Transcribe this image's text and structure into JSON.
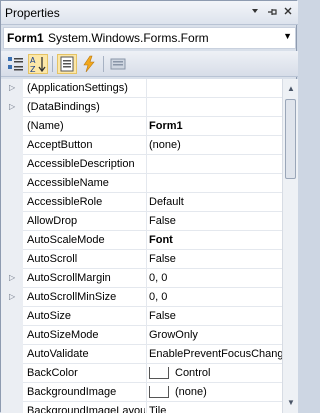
{
  "window": {
    "title": "Properties"
  },
  "object_selector": {
    "name": "Form1",
    "type": "System.Windows.Forms.Form"
  },
  "toolbar": {
    "buttons": [
      {
        "icon": "categorized-icon",
        "active": false
      },
      {
        "icon": "alphabetical-icon",
        "active": true
      },
      {
        "icon": "properties-icon",
        "active": true
      },
      {
        "icon": "events-icon",
        "active": false
      },
      {
        "icon": "property-pages-icon",
        "active": false
      }
    ]
  },
  "properties": [
    {
      "name": "(ApplicationSettings)",
      "value": "",
      "expandable": true
    },
    {
      "name": "(DataBindings)",
      "value": "",
      "expandable": true
    },
    {
      "name": "(Name)",
      "value": "Form1",
      "bold": true
    },
    {
      "name": "AcceptButton",
      "value": "(none)"
    },
    {
      "name": "AccessibleDescription",
      "value": ""
    },
    {
      "name": "AccessibleName",
      "value": ""
    },
    {
      "name": "AccessibleRole",
      "value": "Default"
    },
    {
      "name": "AllowDrop",
      "value": "False"
    },
    {
      "name": "AutoScaleMode",
      "value": "Font",
      "bold": true
    },
    {
      "name": "AutoScroll",
      "value": "False"
    },
    {
      "name": "AutoScrollMargin",
      "value": "0, 0",
      "expandable": true
    },
    {
      "name": "AutoScrollMinSize",
      "value": "0, 0",
      "expandable": true
    },
    {
      "name": "AutoSize",
      "value": "False"
    },
    {
      "name": "AutoSizeMode",
      "value": "GrowOnly"
    },
    {
      "name": "AutoValidate",
      "value": "EnablePreventFocusChange"
    },
    {
      "name": "BackColor",
      "value": "Control",
      "swatch": "#ffffff"
    },
    {
      "name": "BackgroundImage",
      "value": "(none)",
      "swatch": "#ffffff"
    },
    {
      "name": "BackgroundImageLayout",
      "value": "Tile"
    }
  ]
}
